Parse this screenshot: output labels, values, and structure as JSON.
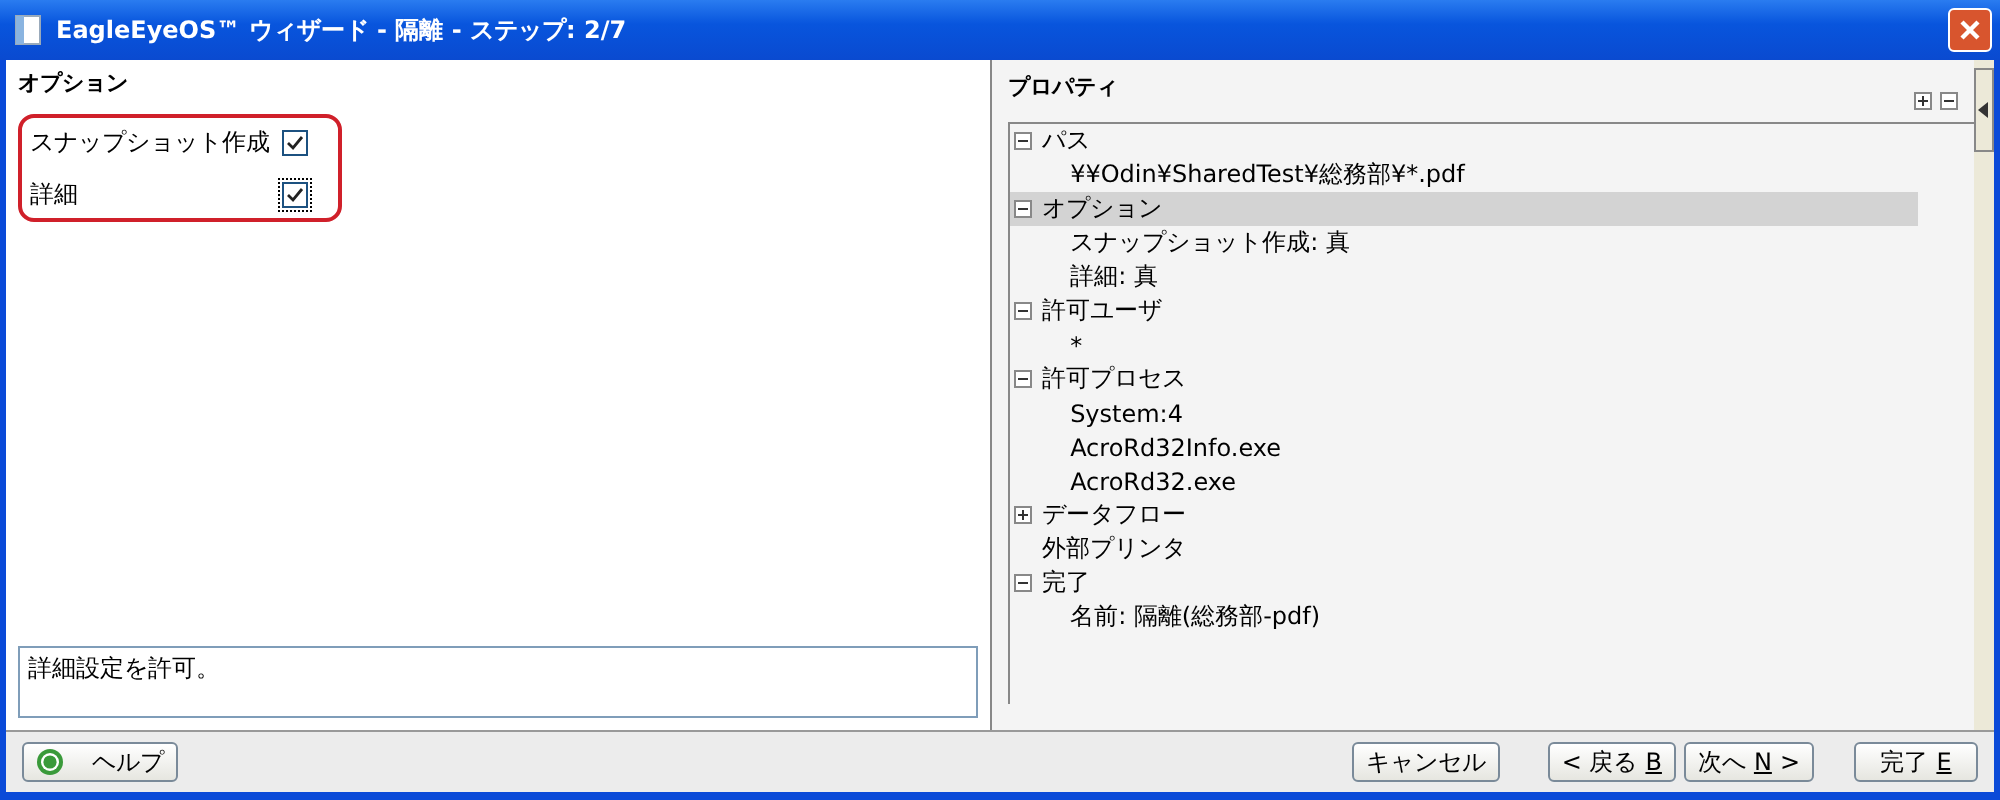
{
  "window": {
    "title": "EagleEyeOS™ ウィザード - 隔離 - ステップ: 2/7"
  },
  "options": {
    "heading": "オプション",
    "items": [
      {
        "label": "スナップショット作成",
        "checked": true,
        "focused": false
      },
      {
        "label": "詳細",
        "checked": true,
        "focused": true
      }
    ],
    "description": "詳細設定を許可。"
  },
  "properties": {
    "heading": "プロパティ",
    "tree": [
      {
        "label": "パス",
        "expanded": true,
        "selected": false,
        "children": [
          {
            "label": "¥¥Odin¥SharedTest¥総務部¥*.pdf"
          }
        ]
      },
      {
        "label": "オプション",
        "expanded": true,
        "selected": true,
        "children": [
          {
            "label": "スナップショット作成: 真"
          },
          {
            "label": "詳細: 真"
          }
        ]
      },
      {
        "label": "許可ユーザ",
        "expanded": true,
        "selected": false,
        "children": [
          {
            "label": "*"
          }
        ]
      },
      {
        "label": "許可プロセス",
        "expanded": true,
        "selected": false,
        "children": [
          {
            "label": "System:4"
          },
          {
            "label": "AcroRd32Info.exe"
          },
          {
            "label": "AcroRd32.exe"
          }
        ]
      },
      {
        "label": "データフロー",
        "expanded": false,
        "selected": false
      },
      {
        "label": "外部プリンタ",
        "selected": false
      },
      {
        "label": "完了",
        "expanded": true,
        "selected": false,
        "children": [
          {
            "label": "名前: 隔離(総務部-pdf)"
          }
        ]
      }
    ]
  },
  "footer": {
    "help": "ヘルプ",
    "buttons": [
      {
        "before": "キャンセル"
      },
      {
        "before": "< 戻る ",
        "key": "B"
      },
      {
        "before": "次へ ",
        "key": "N",
        "after": " >"
      },
      {
        "before": "完了 ",
        "key": "E"
      }
    ]
  }
}
